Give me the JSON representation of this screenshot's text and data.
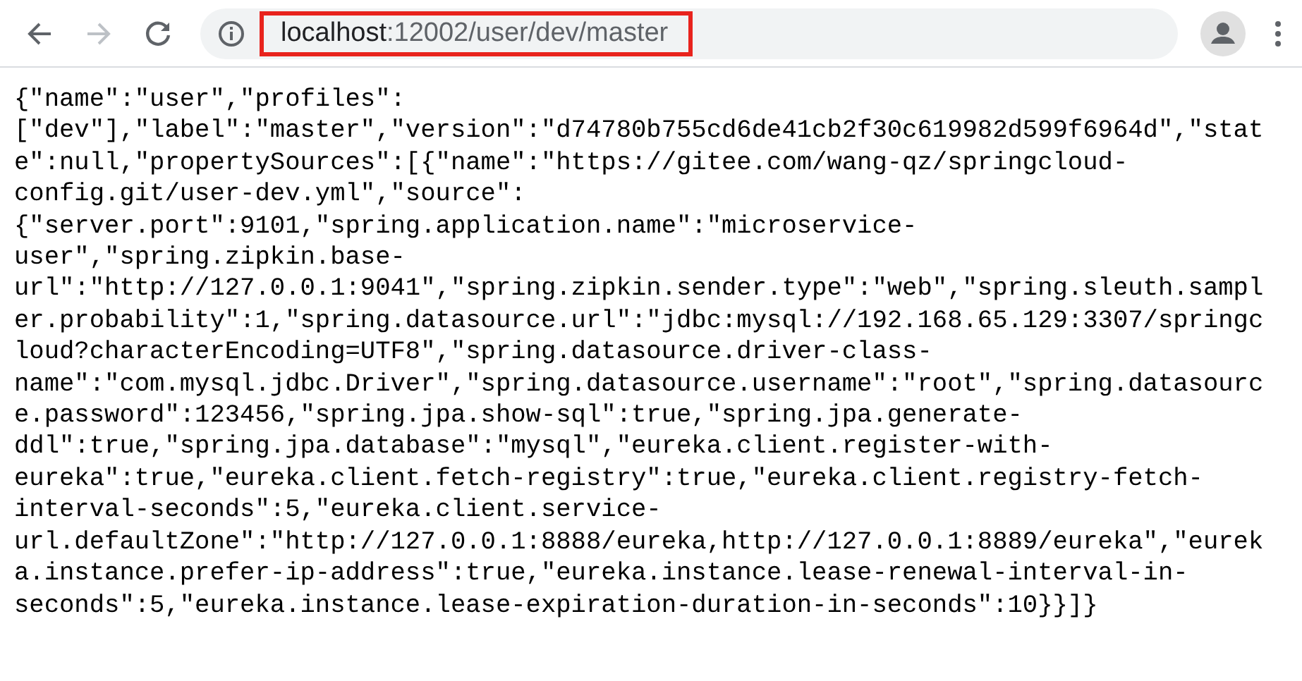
{
  "toolbar": {
    "back": {
      "disabled": false
    },
    "forward": {
      "disabled": true
    },
    "address": {
      "host": "localhost",
      "path": ":12002/user/dev/master",
      "highlighted": true
    }
  },
  "body": {
    "lines": [
      "{\"name\":\"user\",\"profiles\":",
      "[\"dev\"],\"label\":\"master\",\"version\":\"d74780b755cd6de41cb2f30c619982d599f6964d\",\"stat",
      "e\":null,\"propertySources\":[{\"name\":\"https://gitee.com/wang-qz/springcloud-",
      "config.git/user-dev.yml\",\"source\":",
      "{\"server.port\":9101,\"spring.application.name\":\"microservice-",
      "user\",\"spring.zipkin.base-",
      "url\":\"http://127.0.0.1:9041\",\"spring.zipkin.sender.type\":\"web\",\"spring.sleuth.sampl",
      "er.probability\":1,\"spring.datasource.url\":\"jdbc:mysql://192.168.65.129:3307/springc",
      "loud?characterEncoding=UTF8\",\"spring.datasource.driver-class-",
      "name\":\"com.mysql.jdbc.Driver\",\"spring.datasource.username\":\"root\",\"spring.datasourc",
      "e.password\":123456,\"spring.jpa.show-sql\":true,\"spring.jpa.generate-",
      "ddl\":true,\"spring.jpa.database\":\"mysql\",\"eureka.client.register-with-",
      "eureka\":true,\"eureka.client.fetch-registry\":true,\"eureka.client.registry-fetch-",
      "interval-seconds\":5,\"eureka.client.service-",
      "url.defaultZone\":\"http://127.0.0.1:8888/eureka,http://127.0.0.1:8889/eureka\",\"eurek",
      "a.instance.prefer-ip-address\":true,\"eureka.instance.lease-renewal-interval-in-",
      "seconds\":5,\"eureka.instance.lease-expiration-duration-in-seconds\":10}}]}"
    ]
  }
}
